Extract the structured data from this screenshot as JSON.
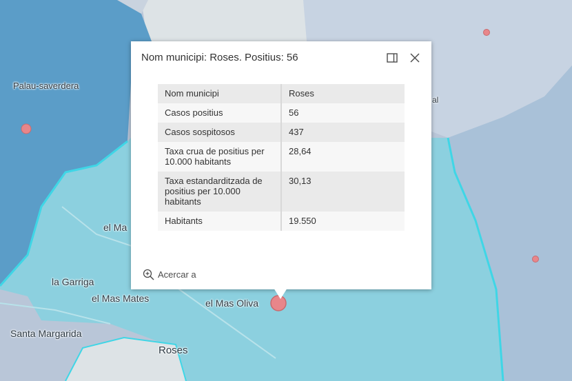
{
  "map": {
    "labels": {
      "palau": "Palau-saverdera",
      "elma": "el Ma",
      "garriga": "la Garriga",
      "masmates": "el Mas Mates",
      "masoliva": "el Mas Oliva",
      "santamargarida": "Santa Margarida",
      "roses": "Roses",
      "partial_l": "al"
    },
    "colors": {
      "municipality_dark": "#5b9dc8",
      "selected_municipality": "#8cd0df",
      "highlight_outline": "#3fd6e6",
      "land_neutral": "#dde3e6",
      "point_marker": "#e8868a"
    }
  },
  "popup": {
    "title": "Nom municipi: Roses. Positius: 56",
    "dock_icon": "dock-icon",
    "close_icon": "close-icon",
    "rows": [
      {
        "key": "Nom municipi",
        "value": "Roses"
      },
      {
        "key": "Casos positius",
        "value": "56"
      },
      {
        "key": "Casos sospitosos",
        "value": "437"
      },
      {
        "key": "Taxa crua de positius per 10.000 habitants",
        "value": "28,64"
      },
      {
        "key": "Taxa estandarditzada de positius per 10.000 habitants",
        "value": "30,13"
      },
      {
        "key": "Habitants",
        "value": "19.550"
      }
    ],
    "zoom_label": "Acercar a"
  }
}
